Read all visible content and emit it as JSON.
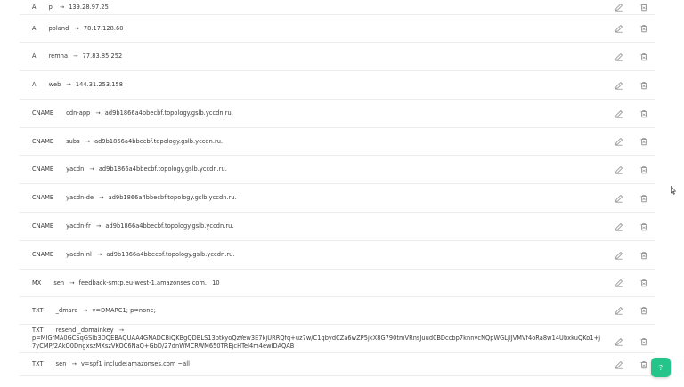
{
  "records": [
    {
      "type": "A",
      "name": "pl",
      "value": "139.28.97.25"
    },
    {
      "type": "A",
      "name": "poland",
      "value": "78.17.128.60"
    },
    {
      "type": "A",
      "name": "remna",
      "value": "77.83.85.252"
    },
    {
      "type": "A",
      "name": "web",
      "value": "144.31.253.158"
    },
    {
      "type": "CNAME",
      "name": "cdn-app",
      "value": "ad9b1866a4bbecbf.topology.gslb.yccdn.ru."
    },
    {
      "type": "CNAME",
      "name": "subs",
      "value": "ad9b1866a4bbecbf.topology.gslb.yccdn.ru."
    },
    {
      "type": "CNAME",
      "name": "yacdn",
      "value": "ad9b1866a4bbecbf.topology.gslb.yccdn.ru."
    },
    {
      "type": "CNAME",
      "name": "yacdn-de",
      "value": "ad9b1866a4bbecbf.topology.gslb.yccdn.ru."
    },
    {
      "type": "CNAME",
      "name": "yacdn-fr",
      "value": "ad9b1866a4bbecbf.topology.gslb.yccdn.ru."
    },
    {
      "type": "CNAME",
      "name": "yacdn-nl",
      "value": "ad9b1866a4bbecbf.topology.gslb.yccdn.ru."
    },
    {
      "type": "MX",
      "name": "sen",
      "value": "feedback-smtp.eu-west-1.amazonses.com.",
      "priority": "10"
    },
    {
      "type": "TXT",
      "name": "_dmarc",
      "value": "v=DMARC1; p=none;"
    },
    {
      "type": "TXT",
      "name": "resend._domainkey",
      "value": "p=MIGfMA0GCSqGSIb3DQEBAQUAA4GNADCBiQKBgQDBLS13btkyoQzYew3E7kjURRQfq+uz7w/C1qbydCZa6wZP5jkX8G790tmVRnsJuud0BDccbp7knnvcNQpWGLjlJVMVf4oRa8w14UbxkuQKo1+j7yCMP/2AkO0DngxszMXszVKOC6NaQ+GbD/27dnWMCRWM650TREjcHTel4m4ewIDAQAB"
    },
    {
      "type": "TXT",
      "name": "sen",
      "value": "v=spf1 include:amazonses.com ~all"
    }
  ],
  "icons": {
    "edit": "pencil-icon",
    "delete": "trash-icon",
    "arrow": "arrow-right-icon"
  },
  "help_button": {
    "label": "?"
  },
  "colors": {
    "accent": "#25c48a",
    "divider": "#ececec",
    "icon": "#8a8a8a"
  }
}
